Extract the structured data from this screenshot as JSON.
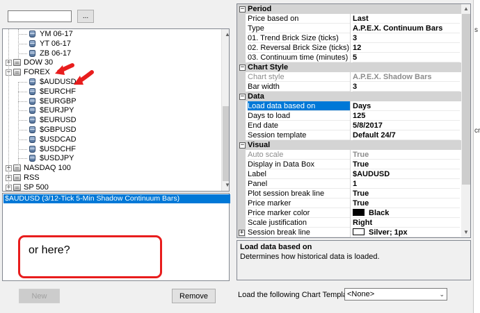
{
  "search": {
    "value": "",
    "browse_label": "..."
  },
  "tree": {
    "items": [
      {
        "label": "YM 06-17",
        "kind": "instrument"
      },
      {
        "label": "YT 06-17",
        "kind": "instrument"
      },
      {
        "label": "ZB 06-17",
        "kind": "instrument"
      },
      {
        "label": "DOW 30",
        "kind": "folder",
        "expander": "+"
      },
      {
        "label": "FOREX",
        "kind": "folder",
        "expander": "−"
      },
      {
        "label": "$AUDUSD",
        "kind": "instrument"
      },
      {
        "label": "$EURCHF",
        "kind": "instrument"
      },
      {
        "label": "$EURGBP",
        "kind": "instrument"
      },
      {
        "label": "$EURJPY",
        "kind": "instrument"
      },
      {
        "label": "$EURUSD",
        "kind": "instrument"
      },
      {
        "label": "$GBPUSD",
        "kind": "instrument"
      },
      {
        "label": "$USDCAD",
        "kind": "instrument"
      },
      {
        "label": "$USDCHF",
        "kind": "instrument"
      },
      {
        "label": "$USDJPY",
        "kind": "instrument"
      },
      {
        "label": "NASDAQ 100",
        "kind": "folder",
        "expander": "+"
      },
      {
        "label": "RSS",
        "kind": "folder",
        "expander": "+"
      },
      {
        "label": "SP 500",
        "kind": "folder",
        "expander": "+"
      }
    ],
    "scroll_up_glyph": "▲",
    "scroll_down_glyph": "▼"
  },
  "selected_list": {
    "items": [
      "$AUDUSD (3/12-Tick 5-Min Shadow Continuum Bars)"
    ]
  },
  "annotation": {
    "callout_text": "or here?",
    "arrow_color": "#e81d1d"
  },
  "buttons": {
    "new_label": "New",
    "remove_label": "Remove"
  },
  "properties": {
    "categories": [
      {
        "name": "Period",
        "expander": "−",
        "rows": [
          {
            "name": "Price based on",
            "value": "Last"
          },
          {
            "name": "Type",
            "value": "A.P.E.X. Continuum Bars"
          },
          {
            "name": "01. Trend Brick Size (ticks)",
            "value": "3"
          },
          {
            "name": "02. Reversal Brick Size (ticks)",
            "value": "12"
          },
          {
            "name": "03. Continuum time (minutes)",
            "value": "5"
          }
        ]
      },
      {
        "name": "Chart Style",
        "expander": "−",
        "rows": [
          {
            "name": "Chart style",
            "value": "A.P.E.X. Shadow Bars",
            "disabled": true
          },
          {
            "name": "Bar width",
            "value": "3"
          }
        ]
      },
      {
        "name": "Data",
        "expander": "−",
        "rows": [
          {
            "name": "Load data based on",
            "value": "Days",
            "selected": true
          },
          {
            "name": "Days to load",
            "value": "125"
          },
          {
            "name": "End date",
            "value": "5/8/2017"
          },
          {
            "name": "Session template",
            "value": "Default 24/7"
          }
        ]
      },
      {
        "name": "Visual",
        "expander": "−",
        "rows": [
          {
            "name": "Auto scale",
            "value": "True",
            "disabled": true
          },
          {
            "name": "Display in Data Box",
            "value": "True"
          },
          {
            "name": "Label",
            "value": "$AUDUSD"
          },
          {
            "name": "Panel",
            "value": "1"
          },
          {
            "name": "Plot session break line",
            "value": "True"
          },
          {
            "name": "Price marker",
            "value": "True"
          },
          {
            "name": "Price marker color",
            "value": "Black",
            "swatch": "#000000"
          },
          {
            "name": "Scale justification",
            "value": "Right"
          },
          {
            "name": "Session break line",
            "value": "Silver; 1px",
            "swatch": "#ffffff",
            "expander": "+"
          }
        ]
      }
    ],
    "scroll_up_glyph": "▲",
    "scroll_down_glyph": "▼"
  },
  "description": {
    "title": "Load data based on",
    "text": "Determines how historical data is loaded."
  },
  "template": {
    "label": "Load the following Chart Template:",
    "selected": "<None>",
    "chevron": "⌄"
  },
  "edge": {
    "a": "s",
    "b": "cr"
  }
}
